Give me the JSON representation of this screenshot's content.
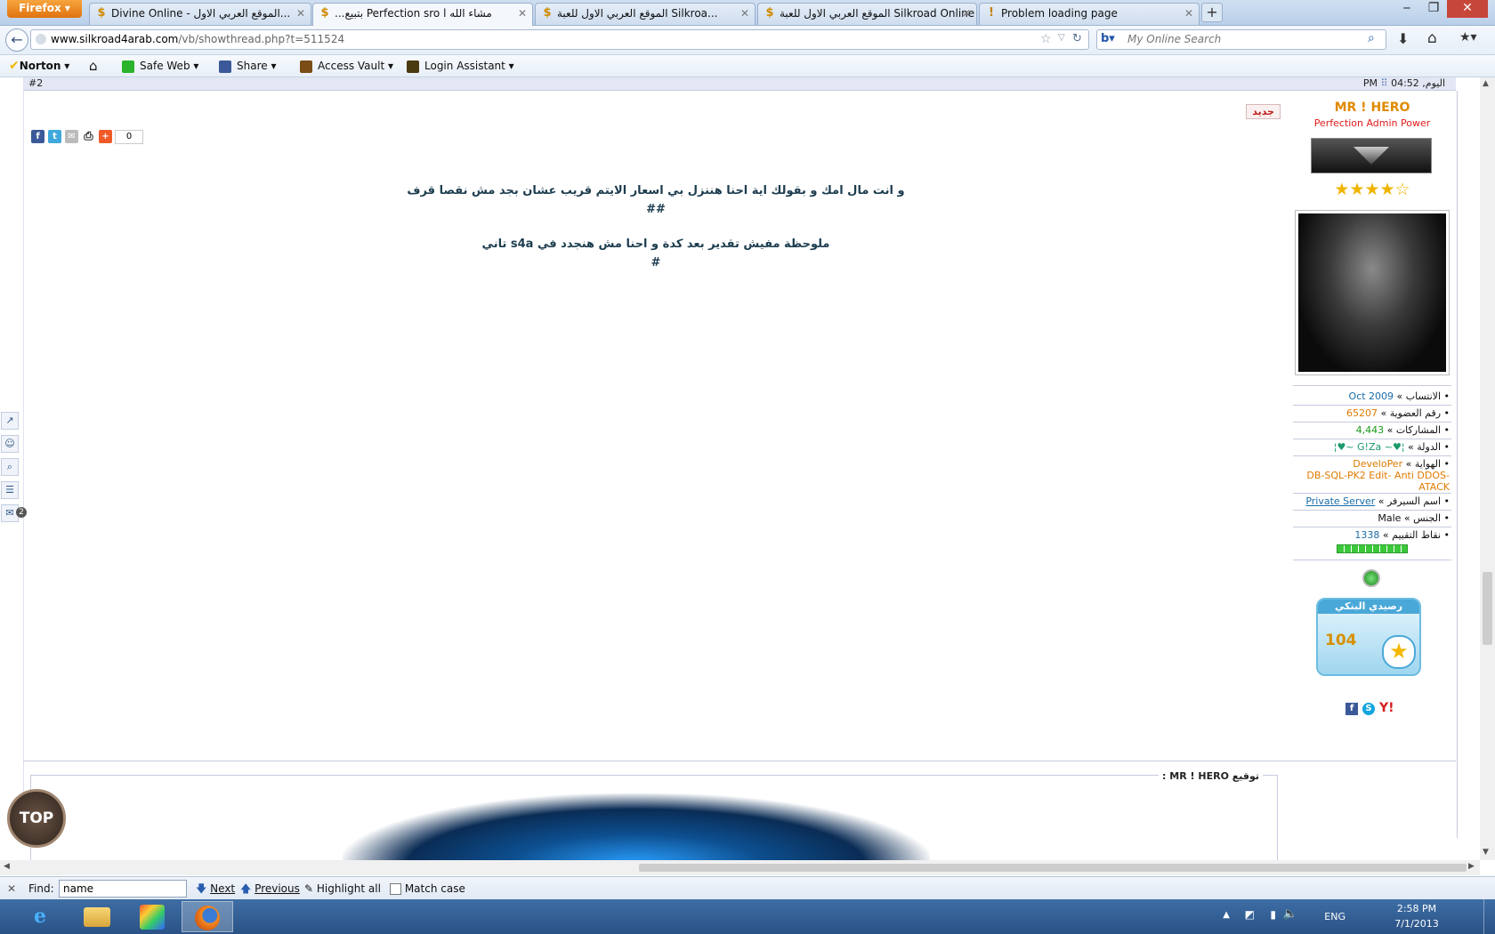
{
  "browser": {
    "firefox_button": "Firefox",
    "tabs": [
      {
        "title": "Divine Online - الموقع العربي الاول...",
        "icon": "$"
      },
      {
        "title": "...بتبيع Perfection sro l مشاء الله",
        "icon": "$"
      },
      {
        "title": "الموقع العربي الاول للعبة Silkroa...",
        "icon": "$"
      },
      {
        "title": "الموقع العربي الاول للعبة Silkroad Online",
        "icon": "$"
      },
      {
        "title": "Problem loading page",
        "icon": "!"
      }
    ],
    "url_domain": "www.silkroad4arab.com",
    "url_path": "/vb/showthread.php?t=511524",
    "search_placeholder": "My Online Search"
  },
  "norton_toolbar": {
    "norton": "Norton",
    "safe_web": "Safe Web",
    "share": "Share",
    "access_vault": "Access Vault",
    "login_assistant": "Login Assistant"
  },
  "post": {
    "number": "#2",
    "time": "اليوم, 04:52 PM",
    "new_badge": "جديد",
    "share_count": "0",
    "line1": "و انت مال امك و بقولك اية احنا هننزل بي اسعار الايتم قريب عشان بجد مش نقصا قرف",
    "line2": "##",
    "line3": "ملوحظة مفيش تقدير بعد كدة و احنا مش هنجدد في s4a تاني",
    "line4": "#",
    "signature_label": "توقيع MR ! HERO :"
  },
  "user": {
    "name": "MR ! HERO",
    "title": "Perfection Admin Power",
    "stars": "★★★★☆",
    "info": [
      {
        "label": "• الانتساب »",
        "value": "Oct 2009"
      },
      {
        "label": "• رقم العضوية »",
        "value": "65207"
      },
      {
        "label": "• المشاركات »",
        "value": "4,443"
      },
      {
        "label": "• الدولة »",
        "value": "¦♥~ G!Za ~♥¦"
      },
      {
        "label": "• الهواية »",
        "value": "DeveloPer"
      },
      {
        "label": "",
        "value": "-DB-SQL-PK2 Edit- Anti DDOS"
      },
      {
        "label": "",
        "value": "ATACK"
      },
      {
        "label": "• اسم السيرفر »",
        "value": "Private Server"
      },
      {
        "label": "• الجنس »",
        "value": "Male"
      },
      {
        "label": "• نقاط التقييم »",
        "value": "1338"
      }
    ],
    "balance_title": "رصيدي البنكي",
    "balance": "104"
  },
  "left_tools": {
    "mail_count": "2"
  },
  "top_button": "TOP",
  "findbar": {
    "find_label": "Find:",
    "find_value": "name",
    "next": "Next",
    "previous": "Previous",
    "highlight_all": "Highlight all",
    "match_case": "Match case"
  },
  "taskbar": {
    "lang": "ENG",
    "time": "2:58 PM",
    "date": "7/1/2013"
  }
}
